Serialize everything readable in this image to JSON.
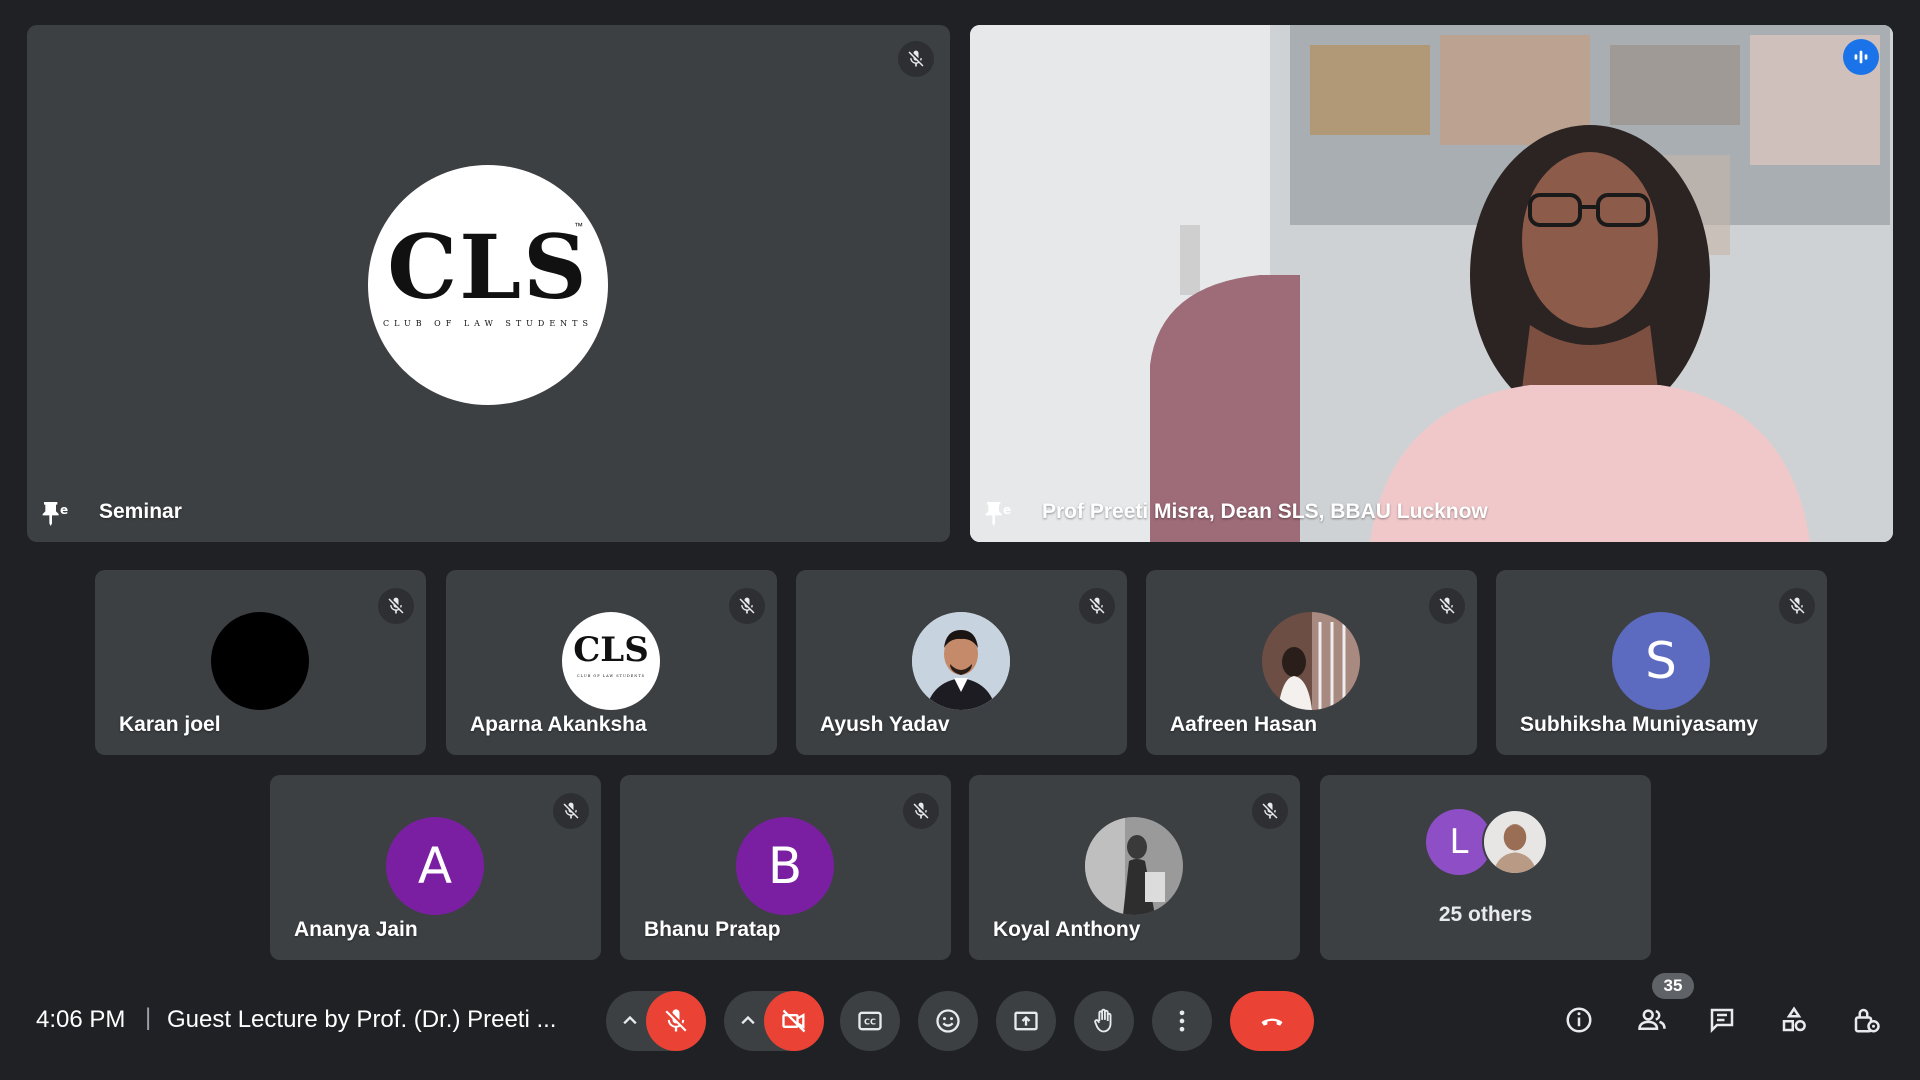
{
  "main_tiles": {
    "seminar": {
      "name": "Seminar",
      "logo_text": "CLS",
      "logo_tm": "™",
      "logo_subtext": "CLUB OF LAW STUDENTS"
    },
    "speaker": {
      "name": "Prof Preeti Misra, Dean SLS, BBAU Lucknow"
    }
  },
  "participants_row1": [
    {
      "name": "Karan joel",
      "avatar_color": "#000000",
      "avatar_letter": ""
    },
    {
      "name": "Aparna Akanksha",
      "avatar_logo": "CLS",
      "avatar_logo_sub": "CLUB OF LAW STUDENTS"
    },
    {
      "name": "Ayush Yadav"
    },
    {
      "name": "Aafreen Hasan"
    },
    {
      "name": "Subhiksha Muniyasamy",
      "avatar_letter": "S",
      "avatar_color": "#5c6bc0"
    }
  ],
  "participants_row2": [
    {
      "name": "Ananya Jain",
      "avatar_letter": "A",
      "avatar_color": "#7b1fa2"
    },
    {
      "name": "Bhanu Pratap",
      "avatar_letter": "B",
      "avatar_color": "#7b1fa2"
    },
    {
      "name": "Koyal Anthony"
    }
  ],
  "others": {
    "label": "25 others",
    "avatar_letter": "L",
    "avatar_color": "#8e4ec6"
  },
  "bottom_bar": {
    "time": "4:06 PM",
    "separator": "|",
    "meeting_title": "Guest Lecture by Prof. (Dr.) Preeti ...",
    "people_count": "35"
  },
  "colors": {
    "background": "#202124",
    "tile": "#3c4043",
    "active_outline": "#8ab4f8",
    "danger": "#ea4335"
  },
  "icons": [
    "mic-off-icon",
    "pin-icon",
    "speaking-indicator-icon",
    "chevron-up-icon",
    "video-off-icon",
    "captions-icon",
    "emoji-icon",
    "present-icon",
    "raise-hand-icon",
    "more-options-icon",
    "end-call-icon",
    "info-icon",
    "people-icon",
    "chat-icon",
    "activities-icon",
    "host-controls-icon"
  ]
}
